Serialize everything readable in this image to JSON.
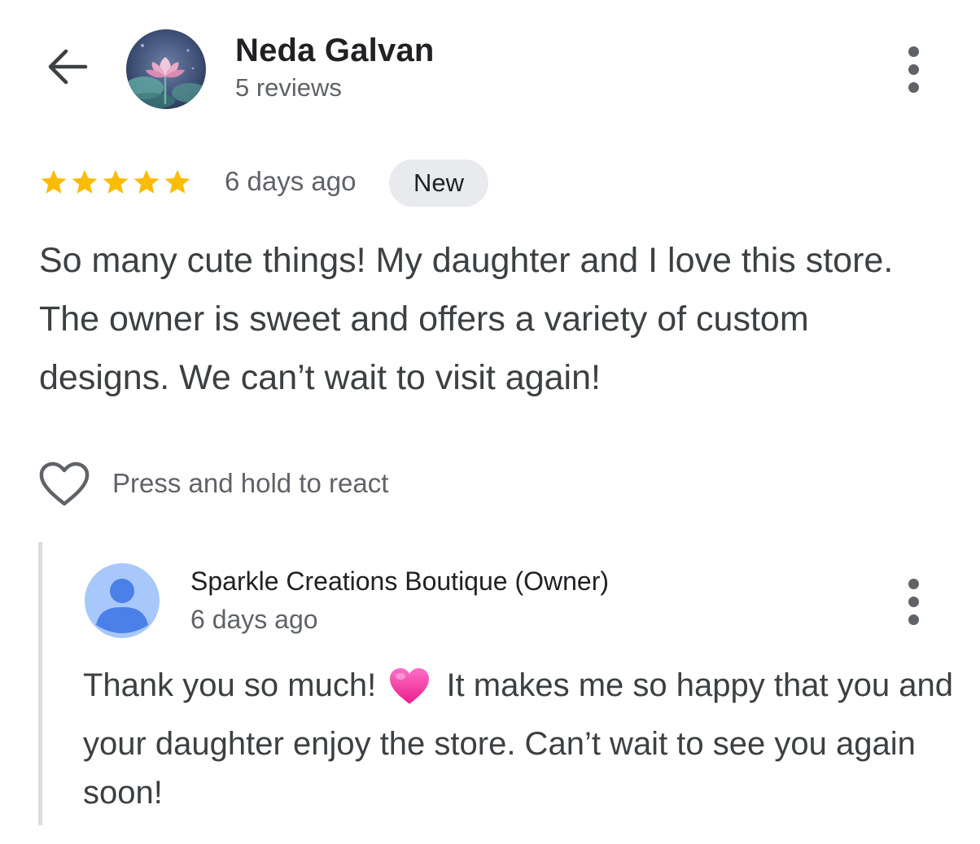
{
  "reviewer": {
    "name": "Neda Galvan",
    "reviews_count": "5 reviews",
    "avatar_icon": "lotus-flower-avatar"
  },
  "review": {
    "rating": 5,
    "rating_max": 5,
    "star_color": "#fbbc04",
    "date": "6 days ago",
    "badge": "New",
    "text": "So many cute things! My daughter and I love this store. The owner is sweet and offers a variety of custom designs. We can’t wait to visit again!"
  },
  "react": {
    "icon": "heart-outline-icon",
    "label": "Press and hold to react"
  },
  "owner_reply": {
    "name": "Sparkle Creations Boutique (Owner)",
    "date": "6 days ago",
    "avatar_icon": "person-icon",
    "text_before_emoji": "Thank you so much!",
    "emoji": "pink-heart-emoji",
    "text_after_emoji": "It makes me so happy that you and your daughter enjoy the store. Can’t wait to see you again soon!"
  },
  "icons": {
    "back": "arrow-back-icon",
    "more": "more-vert-icon"
  }
}
